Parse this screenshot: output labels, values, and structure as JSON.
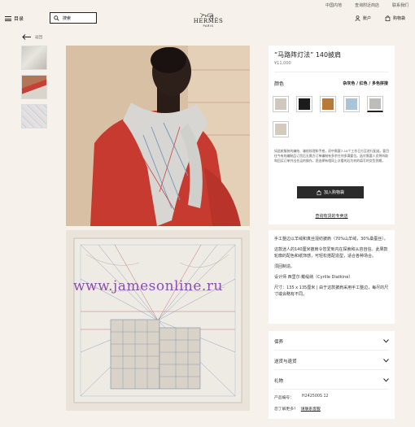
{
  "top_links": [
    "中国内地",
    "查询附近商店",
    "联系我们"
  ],
  "header": {
    "menu_label": "目录",
    "search_placeholder": "搜索",
    "brand": "HERMÈS",
    "brand_city": "PARIS",
    "account_label": "账户",
    "cart_label": "购物袋"
  },
  "back_label": "返回",
  "product": {
    "title": "“马路阵灯法” 140披肩",
    "price": "¥11,000",
    "color_label": "颜色",
    "color_name": "杂灰色 / 红色 / 多色拼接",
    "swatches": [
      "#cfc8bd",
      "#1c1c1c",
      "#b87a36",
      "#a9c4d8",
      "#bdbcba",
      "#d3cbbe"
    ],
    "description": "如此款服装的编结、皱纹纹理和手感，初中需要7-10个工作日方至进行配送。要目往今有的编制品订货后无需方订单编制有多余任何多满要位。函对需要人员将听取和回买订单并出任运的操作，您选择有相同上次看的后为何的填写的交货到期。",
    "add_to_cart": "加入购物袋",
    "store_link": "查询有货的专卖店"
  },
  "details": {
    "para1": "手工整边以羊绒和真丝混纺披肩（70%山羊绒，30%桑蚕丝）。",
    "para2": "这款迷人的140厘米披肩令您爱到内在探索和从容自信。此果款轮廓的配色和纸饰感，可轻松搭配造型，适合各种场合。",
    "para3": "须回制造。",
    "designer": "设计师 西里尔·戴缇纳（Cyrille Diatkine）",
    "size": "尺寸：135 x 135厘米 | 由于这款披肩采用手工整边，每尽的尺寸或会略有不同。"
  },
  "accordion": [
    "保养",
    "送货与退货",
    "礼物"
  ],
  "ref_label": "产品编号：",
  "ref_value": "H242500S 12",
  "help_label": "您了解更多？",
  "help_link": "请联系客服",
  "watermark": "www.jamesonline.ru"
}
